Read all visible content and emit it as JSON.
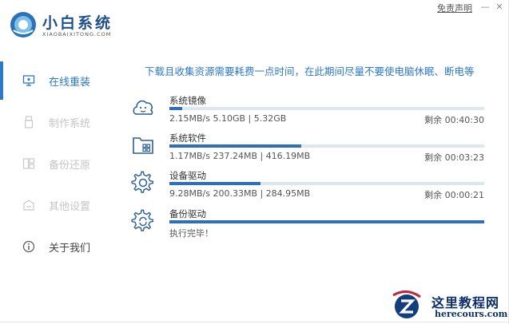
{
  "header": {
    "title": "小白系统",
    "subtitle": "XIAOBAIXITONG.COM",
    "disclaimer": "免责声明",
    "minimize": "—",
    "close": "✕"
  },
  "sidebar": {
    "items": [
      {
        "label": "在线重装",
        "icon": "monitor-icon",
        "active": true
      },
      {
        "label": "制作系统",
        "icon": "usb-icon",
        "active": false
      },
      {
        "label": "备份还原",
        "icon": "backup-icon",
        "active": false
      },
      {
        "label": "其他设置",
        "icon": "settings-box-icon",
        "active": false
      },
      {
        "label": "关于我们",
        "icon": "info-icon",
        "active": false
      }
    ]
  },
  "main": {
    "notice": "下载且收集资源需要耗费一点时间，在此期间尽量不要使电脑休眠、断电等",
    "downloads": [
      {
        "name": "系统镜像",
        "stats": "2.15MB/s 5.10GB | 5.32GB",
        "remaining": "剩余 00:40:30",
        "progress": 0.04,
        "icon": "smiley-cloud-icon"
      },
      {
        "name": "系统软件",
        "stats": "1.17MB/s 237.24MB | 416.19MB",
        "remaining": "剩余 00:03:23",
        "progress": 0.42,
        "icon": "folder-apps-icon"
      },
      {
        "name": "设备驱动",
        "stats": "9.28MB/s 200.33MB | 284.95MB",
        "remaining": "剩余 00:00:21",
        "progress": 0.29,
        "icon": "gear-icon"
      },
      {
        "name": "备份驱动",
        "stats": "执行完毕！",
        "remaining": "",
        "progress": 1.0,
        "icon": "gear-refresh-icon"
      }
    ]
  },
  "watermark": {
    "name": "这里教程网",
    "url": "herecours.com"
  },
  "colors": {
    "accent": "#2d78c8",
    "bar_fill": "#2d6fb8",
    "bar_track": "#dde7f1"
  }
}
